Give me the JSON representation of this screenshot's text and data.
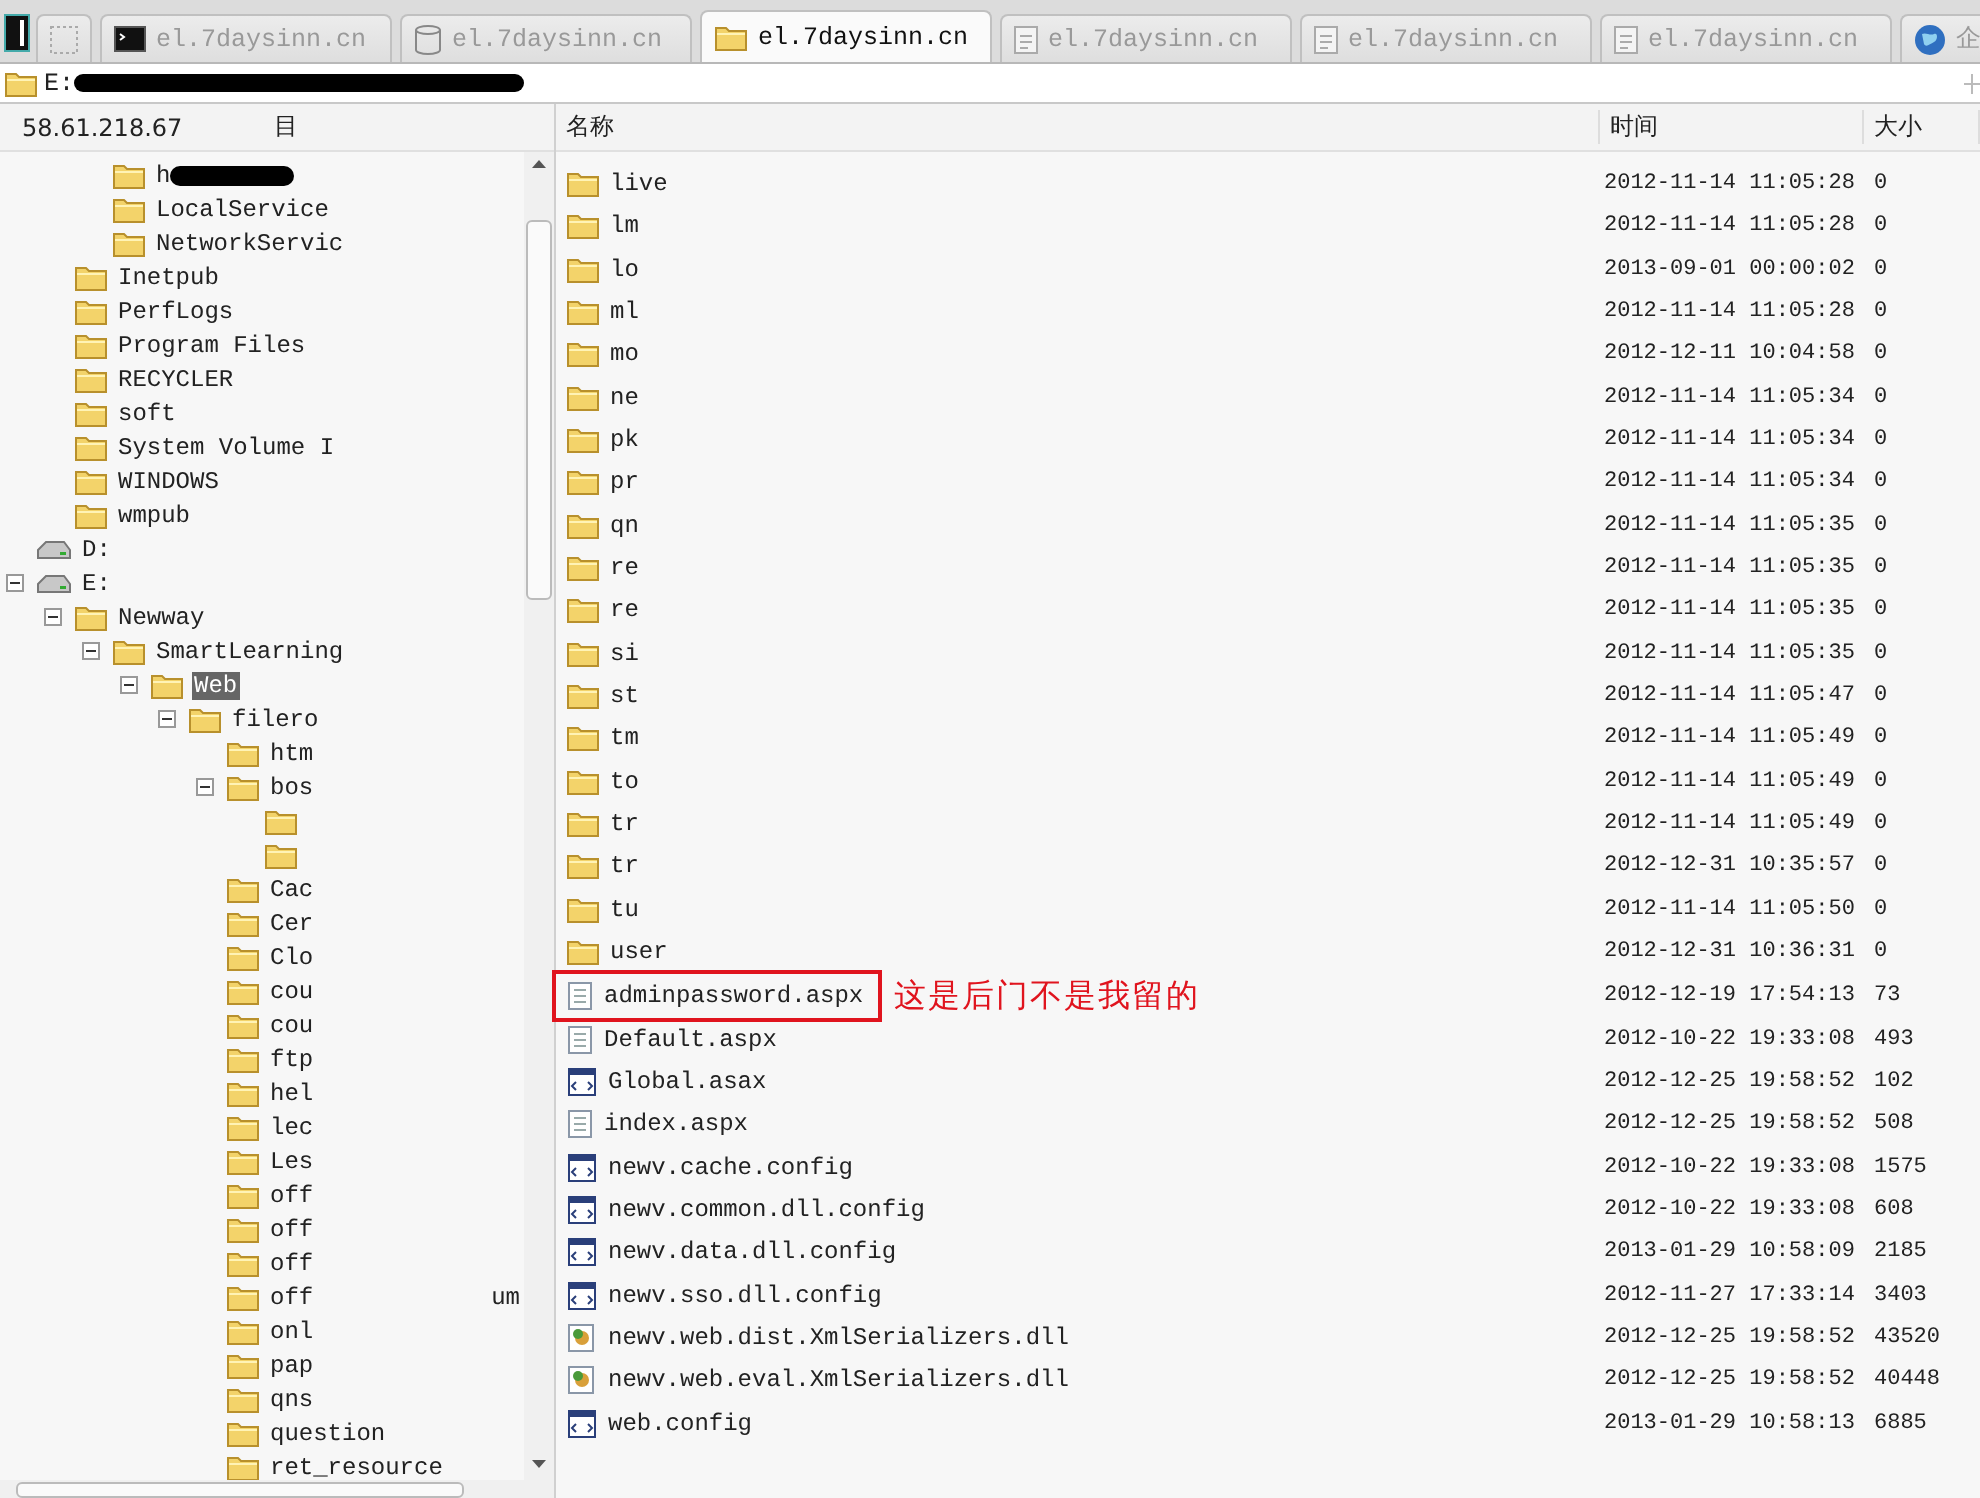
{
  "tabs": [
    {
      "kind": "blank",
      "selected": false
    },
    {
      "kind": "terminal",
      "label": "el.7daysinn.cn",
      "selected": false
    },
    {
      "kind": "database",
      "label": "el.7daysinn.cn",
      "selected": false
    },
    {
      "kind": "folder",
      "label": "el.7daysinn.cn",
      "selected": true
    },
    {
      "kind": "document",
      "label": "el.7daysinn.cn",
      "selected": false
    },
    {
      "kind": "document",
      "label": "el.7daysinn.cn",
      "selected": false
    },
    {
      "kind": "document",
      "label": "el.7daysinn.cn",
      "selected": false
    },
    {
      "kind": "globe",
      "label": "企",
      "selected": false
    }
  ],
  "path_bar": {
    "path": "E:",
    "redacted": true
  },
  "tree": {
    "host": "58.61.218.67",
    "column": "目",
    "items": [
      {
        "kind": "hidden",
        "children": [
          {
            "kind": "hidden",
            "children": [
              {
                "kind": "folder",
                "label": "h",
                "redacted": true,
                "selected": false
              },
              {
                "kind": "folder",
                "label": "LocalService",
                "selected": false
              },
              {
                "kind": "folder",
                "label": "NetworkServic",
                "selected": false
              }
            ]
          },
          {
            "kind": "folder",
            "label": "Inetpub",
            "selected": false
          },
          {
            "kind": "folder",
            "label": "PerfLogs",
            "selected": false
          },
          {
            "kind": "folder",
            "label": "Program Files",
            "selected": false
          },
          {
            "kind": "folder",
            "label": "RECYCLER",
            "selected": false
          },
          {
            "kind": "folder",
            "label": "soft",
            "selected": false
          },
          {
            "kind": "folder",
            "label": "System Volume I",
            "selected": false
          },
          {
            "kind": "folder",
            "label": "WINDOWS",
            "selected": false
          },
          {
            "kind": "folder",
            "label": "wmpub",
            "selected": false
          }
        ]
      },
      {
        "kind": "drive",
        "label": "D:",
        "selected": false
      },
      {
        "kind": "drive",
        "label": "E:",
        "selected": false,
        "expanded": true,
        "children": [
          {
            "kind": "folder",
            "label": "Newway",
            "selected": false,
            "expanded": true,
            "children": [
              {
                "kind": "folder",
                "label": "SmartLearning",
                "selected": false,
                "expanded": true,
                "children": [
                  {
                    "kind": "folder",
                    "label": "Web",
                    "selected": true,
                    "expanded": true,
                    "children": [
                      {
                        "kind": "folder",
                        "label": "filero",
                        "selected": false,
                        "expanded": true,
                        "children": [
                          {
                            "kind": "folder",
                            "label": "htm",
                            "selected": false
                          },
                          {
                            "kind": "folder",
                            "label": "bos",
                            "selected": false,
                            "expanded": true,
                            "children": [
                              {
                                "kind": "folder"
                              },
                              {
                                "kind": "folder"
                              }
                            ]
                          },
                          {
                            "kind": "folder",
                            "label": "Cac",
                            "selected": false
                          },
                          {
                            "kind": "folder",
                            "label": "Cer",
                            "selected": false
                          },
                          {
                            "kind": "folder",
                            "label": "Clo",
                            "selected": false
                          },
                          {
                            "kind": "folder",
                            "label": "cou",
                            "selected": false
                          },
                          {
                            "kind": "folder",
                            "label": "cou",
                            "selected": false
                          },
                          {
                            "kind": "folder",
                            "label": "ftp",
                            "selected": false
                          },
                          {
                            "kind": "folder",
                            "label": "hel",
                            "selected": false
                          },
                          {
                            "kind": "folder",
                            "label": "lec",
                            "selected": false
                          },
                          {
                            "kind": "folder",
                            "label": "Les",
                            "selected": false
                          },
                          {
                            "kind": "folder",
                            "label": "off",
                            "selected": false
                          },
                          {
                            "kind": "folder",
                            "label": "off",
                            "selected": false
                          },
                          {
                            "kind": "folder",
                            "label": "off",
                            "selected": false
                          },
                          {
                            "kind": "folder",
                            "label": "off",
                            "label_tail": "um",
                            "selected": false
                          },
                          {
                            "kind": "folder",
                            "label": "onl",
                            "selected": false
                          },
                          {
                            "kind": "folder",
                            "label": "pap",
                            "selected": false
                          },
                          {
                            "kind": "folder",
                            "label": "qns",
                            "selected": false
                          },
                          {
                            "kind": "folder",
                            "label": "question",
                            "selected": false
                          },
                          {
                            "kind": "folder",
                            "label": "ret_resource",
                            "selected": false
                          }
                        ]
                      }
                    ]
                  }
                ]
              }
            ]
          }
        ]
      }
    ]
  },
  "file_list": {
    "columns": [
      "名称",
      "时间",
      "大小"
    ],
    "rows": [
      {
        "kind": "folder",
        "name": "live",
        "time": "2012-11-14 11:05:28",
        "size": "0"
      },
      {
        "kind": "folder",
        "name": "lm",
        "time": "2012-11-14 11:05:28",
        "size": "0"
      },
      {
        "kind": "folder",
        "name": "lo",
        "time": "2013-09-01 00:00:02",
        "size": "0"
      },
      {
        "kind": "folder",
        "name": "ml",
        "time": "2012-11-14 11:05:28",
        "size": "0"
      },
      {
        "kind": "folder",
        "name": "mo",
        "time": "2012-12-11 10:04:58",
        "size": "0"
      },
      {
        "kind": "folder",
        "name": "ne",
        "time": "2012-11-14 11:05:34",
        "size": "0"
      },
      {
        "kind": "folder",
        "name": "pk",
        "time": "2012-11-14 11:05:34",
        "size": "0"
      },
      {
        "kind": "folder",
        "name": "pr",
        "time": "2012-11-14 11:05:34",
        "size": "0"
      },
      {
        "kind": "folder",
        "name": "qn",
        "time": "2012-11-14 11:05:35",
        "size": "0"
      },
      {
        "kind": "folder",
        "name": "re",
        "time": "2012-11-14 11:05:35",
        "size": "0"
      },
      {
        "kind": "folder",
        "name": "re",
        "time": "2012-11-14 11:05:35",
        "size": "0"
      },
      {
        "kind": "folder",
        "name": "si",
        "time": "2012-11-14 11:05:35",
        "size": "0"
      },
      {
        "kind": "folder",
        "name": "st",
        "time": "2012-11-14 11:05:47",
        "size": "0"
      },
      {
        "kind": "folder",
        "name": "tm",
        "time": "2012-11-14 11:05:49",
        "size": "0"
      },
      {
        "kind": "folder",
        "name": "to",
        "time": "2012-11-14 11:05:49",
        "size": "0"
      },
      {
        "kind": "folder",
        "name": "tr",
        "time": "2012-11-14 11:05:49",
        "size": "0"
      },
      {
        "kind": "folder",
        "name": "tr",
        "time": "2012-12-31 10:35:57",
        "size": "0"
      },
      {
        "kind": "folder",
        "name": "tu",
        "time": "2012-11-14 11:05:50",
        "size": "0"
      },
      {
        "kind": "folder",
        "name": "user",
        "time": "2012-12-31 10:36:31",
        "size": "0"
      },
      {
        "kind": "page",
        "name": "adminpassword.aspx",
        "time": "2012-12-19 17:54:13",
        "size": "73",
        "boxed": true,
        "note": "这是后门不是我留的"
      },
      {
        "kind": "page",
        "name": "Default.aspx",
        "time": "2012-10-22 19:33:08",
        "size": "493"
      },
      {
        "kind": "config",
        "name": "Global.asax",
        "time": "2012-12-25 19:58:52",
        "size": "102"
      },
      {
        "kind": "page",
        "name": "index.aspx",
        "time": "2012-12-25 19:58:52",
        "size": "508"
      },
      {
        "kind": "config",
        "name": "newv.cache.config",
        "time": "2012-10-22 19:33:08",
        "size": "1575"
      },
      {
        "kind": "config",
        "name": "newv.common.dll.config",
        "time": "2012-10-22 19:33:08",
        "size": "608"
      },
      {
        "kind": "config",
        "name": "newv.data.dll.config",
        "time": "2013-01-29 10:58:09",
        "size": "2185"
      },
      {
        "kind": "config",
        "name": "newv.sso.dll.config",
        "time": "2012-11-27 17:33:14",
        "size": "3403"
      },
      {
        "kind": "dll",
        "name": "newv.web.dist.XmlSerializers.dll",
        "time": "2012-12-25 19:58:52",
        "size": "43520"
      },
      {
        "kind": "dll",
        "name": "newv.web.eval.XmlSerializers.dll",
        "time": "2012-12-25 19:58:52",
        "size": "40448"
      },
      {
        "kind": "config",
        "name": "web.config",
        "time": "2013-01-29 10:58:13",
        "size": "6885"
      }
    ]
  }
}
